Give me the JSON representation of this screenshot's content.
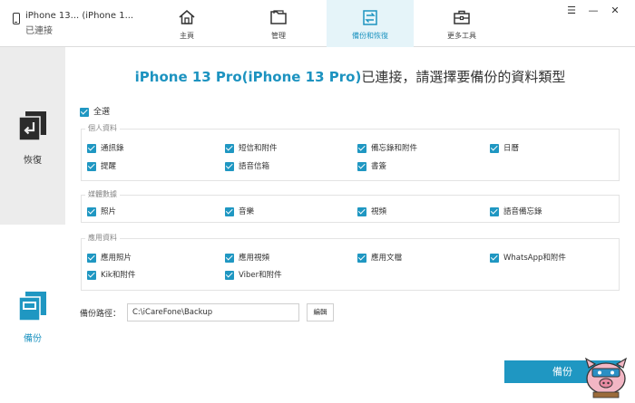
{
  "window": {
    "device_name": "iPhone 13... (iPhone 1...",
    "device_status": "已連接",
    "controls": [
      "☰",
      "—",
      "✕"
    ]
  },
  "nav": {
    "tabs": [
      {
        "label": "主頁",
        "icon": "home-icon"
      },
      {
        "label": "管理",
        "icon": "folder-icon"
      },
      {
        "label": "備份和恢復",
        "icon": "backup-restore-icon",
        "active": true
      },
      {
        "label": "更多工具",
        "icon": "toolbox-icon"
      }
    ]
  },
  "sidebar": {
    "restore_label": "恢復",
    "backup_label": "備份"
  },
  "headline": {
    "device": "iPhone 13 Pro(iPhone 13 Pro)",
    "text": "已連接，請選擇要備份的資料類型"
  },
  "select_all": {
    "label": "全選",
    "checked": true
  },
  "groups": [
    {
      "title": "個人資料",
      "items": [
        {
          "label": "通訊錄",
          "checked": true
        },
        {
          "label": "短信和附件",
          "checked": true
        },
        {
          "label": "備忘錄和附件",
          "checked": true
        },
        {
          "label": "日曆",
          "checked": true
        },
        {
          "label": "提醒",
          "checked": true
        },
        {
          "label": "語音信箱",
          "checked": true
        },
        {
          "label": "書簽",
          "checked": true
        }
      ]
    },
    {
      "title": "媒體數據",
      "items": [
        {
          "label": "照片",
          "checked": true
        },
        {
          "label": "音樂",
          "checked": true
        },
        {
          "label": "視頻",
          "checked": true
        },
        {
          "label": "語音備忘錄",
          "checked": true
        }
      ]
    },
    {
      "title": "應用資料",
      "items": [
        {
          "label": "應用照片",
          "checked": true
        },
        {
          "label": "應用視頻",
          "checked": true
        },
        {
          "label": "應用文檔",
          "checked": true
        },
        {
          "label": "WhatsApp和附件",
          "checked": true
        },
        {
          "label": "Kik和附件",
          "checked": true
        },
        {
          "label": "Viber和附件",
          "checked": true
        }
      ]
    }
  ],
  "backup_path": {
    "label": "備份路徑：",
    "value": "C:\\iCareFone\\Backup",
    "edit_label": "編輯"
  },
  "backup_button": "備份",
  "colors": {
    "accent": "#1f97c2",
    "active_tab_bg": "#e5f4f9",
    "sidebar_bg": "#ececec"
  }
}
